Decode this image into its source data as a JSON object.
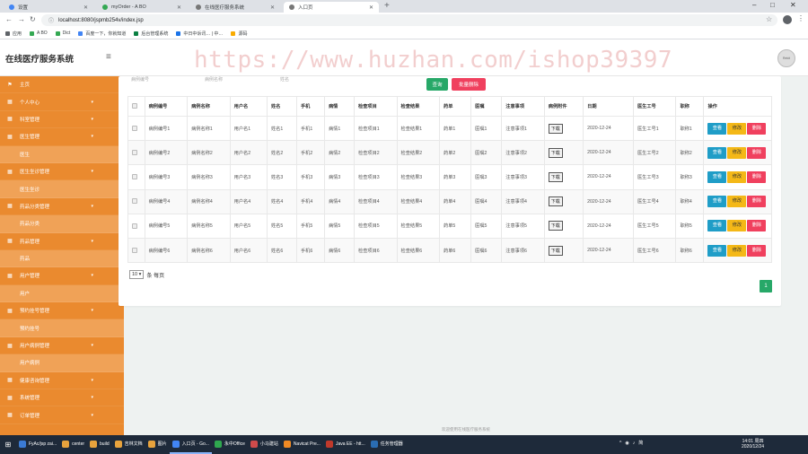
{
  "browser": {
    "tabs": [
      {
        "title": "设置",
        "active": false
      },
      {
        "title": "myOrder - A BO",
        "active": false
      },
      {
        "title": "在线医疗服务系统",
        "active": false
      },
      {
        "title": "入口页",
        "active": true
      }
    ],
    "url": "localhost:8080/jspmb254v/index.jsp",
    "bookmarks": [
      "应用",
      "A BO",
      "Dict",
      "百度一下，你就知道",
      "后台管理系统",
      "中日中诉讯… | 中…",
      "源码"
    ]
  },
  "app": {
    "title": "在线医疗服务系统",
    "avatar_text": "Rekit",
    "watermark": "https://www.huzhan.com/ishop39397"
  },
  "sidebar": {
    "items": [
      {
        "label": "主页",
        "type": "group",
        "icon": "flag-icon",
        "chevron": false
      },
      {
        "label": "个人中心",
        "type": "group",
        "icon": "grid-icon",
        "chevron": true
      },
      {
        "label": "科室管理",
        "type": "group",
        "icon": "grid-icon",
        "chevron": true
      },
      {
        "label": "医生管理",
        "type": "group",
        "icon": "grid-icon",
        "chevron": true
      },
      {
        "label": "医生",
        "type": "sub"
      },
      {
        "label": "医生坐诊管理",
        "type": "group",
        "icon": "grid-icon",
        "chevron": true
      },
      {
        "label": "医生坐诊",
        "type": "sub"
      },
      {
        "label": "药品分类管理",
        "type": "group",
        "icon": "grid-icon",
        "chevron": true
      },
      {
        "label": "药品分类",
        "type": "sub"
      },
      {
        "label": "药品管理",
        "type": "group",
        "icon": "grid-icon",
        "chevron": true
      },
      {
        "label": "药品",
        "type": "sub"
      },
      {
        "label": "用户管理",
        "type": "group",
        "icon": "grid-icon",
        "chevron": true
      },
      {
        "label": "用户",
        "type": "sub"
      },
      {
        "label": "预约挂号管理",
        "type": "group",
        "icon": "grid-icon",
        "chevron": true
      },
      {
        "label": "预约挂号",
        "type": "sub"
      },
      {
        "label": "用户病例管理",
        "type": "group",
        "icon": "grid-icon",
        "chevron": true
      },
      {
        "label": "用户病例",
        "type": "sub"
      },
      {
        "label": "健康咨询管理",
        "type": "group",
        "icon": "grid-icon",
        "chevron": true
      },
      {
        "label": "系统管理",
        "type": "group",
        "icon": "grid-icon",
        "chevron": true
      },
      {
        "label": "订单管理",
        "type": "group",
        "icon": "grid-icon",
        "chevron": true
      }
    ]
  },
  "toolbar": {
    "search_label": "查询",
    "bulk_delete_label": "批量删除",
    "ghost_fields": [
      "病例编号",
      "病例名称",
      "姓名"
    ]
  },
  "table": {
    "headers": [
      "病例编号",
      "病例名称",
      "用户名",
      "姓名",
      "手机",
      "病情",
      "检查项目",
      "检查结果",
      "药单",
      "医嘱",
      "注意事项",
      "病例附件",
      "日期",
      "医生工号",
      "职称",
      "操作"
    ],
    "rows": [
      [
        "病例编号1",
        "病例名称1",
        "用户名1",
        "姓名1",
        "手机1",
        "病情1",
        "检查项目1",
        "检查结果1",
        "药单1",
        "医嘱1",
        "注意事项1",
        "下载",
        "2020-12-24",
        "医生工号1",
        "职称1"
      ],
      [
        "病例编号2",
        "病例名称2",
        "用户名2",
        "姓名2",
        "手机2",
        "病情2",
        "检查项目2",
        "检查结果2",
        "药单2",
        "医嘱2",
        "注意事项2",
        "下载",
        "2020-12-24",
        "医生工号2",
        "职称2"
      ],
      [
        "病例编号3",
        "病例名称3",
        "用户名3",
        "姓名3",
        "手机3",
        "病情3",
        "检查项目3",
        "检查结果3",
        "药单3",
        "医嘱3",
        "注意事项3",
        "下载",
        "2020-12-24",
        "医生工号3",
        "职称3"
      ],
      [
        "病例编号4",
        "病例名称4",
        "用户名4",
        "姓名4",
        "手机4",
        "病情4",
        "检查项目4",
        "检查结果4",
        "药单4",
        "医嘱4",
        "注意事项4",
        "下载",
        "2020-12-24",
        "医生工号4",
        "职称4"
      ],
      [
        "病例编号5",
        "病例名称5",
        "用户名5",
        "姓名5",
        "手机5",
        "病情5",
        "检查项目5",
        "检查结果5",
        "药单5",
        "医嘱5",
        "注意事项5",
        "下载",
        "2020-12-24",
        "医生工号5",
        "职称5"
      ],
      [
        "病例编号6",
        "病例名称6",
        "用户名6",
        "姓名6",
        "手机6",
        "病情6",
        "检查项目6",
        "检查结果6",
        "药单6",
        "医嘱6",
        "注意事项6",
        "下载",
        "2020-12-24",
        "医生工号6",
        "职称6"
      ]
    ],
    "actions": {
      "view": "查看",
      "edit": "修改",
      "delete": "删除"
    }
  },
  "pager": {
    "page_size": "10",
    "page_size_suffix": "条 每页",
    "current_page": "1"
  },
  "footer": "欢迎使用在线医疗服务系统",
  "taskbar": {
    "apps": [
      "FyAc/jsp zai...",
      "center",
      "build",
      "吉林文档",
      "图片",
      "入口页 - Go...",
      "永中Office",
      "小马建站",
      "Navicat Pre...",
      "Java EE - htt...",
      "任务管理器"
    ],
    "clock_time": "14:01 周四",
    "clock_date": "2020/12/24",
    "ime": "简"
  },
  "colors": {
    "sidebar_bg": "#ea8a2f",
    "sidebar_sub_bg": "#f0a257",
    "search_btn": "#27a868",
    "danger": "#f0405e",
    "view_btn": "#1f9dc7",
    "edit_btn": "#f4b817"
  }
}
